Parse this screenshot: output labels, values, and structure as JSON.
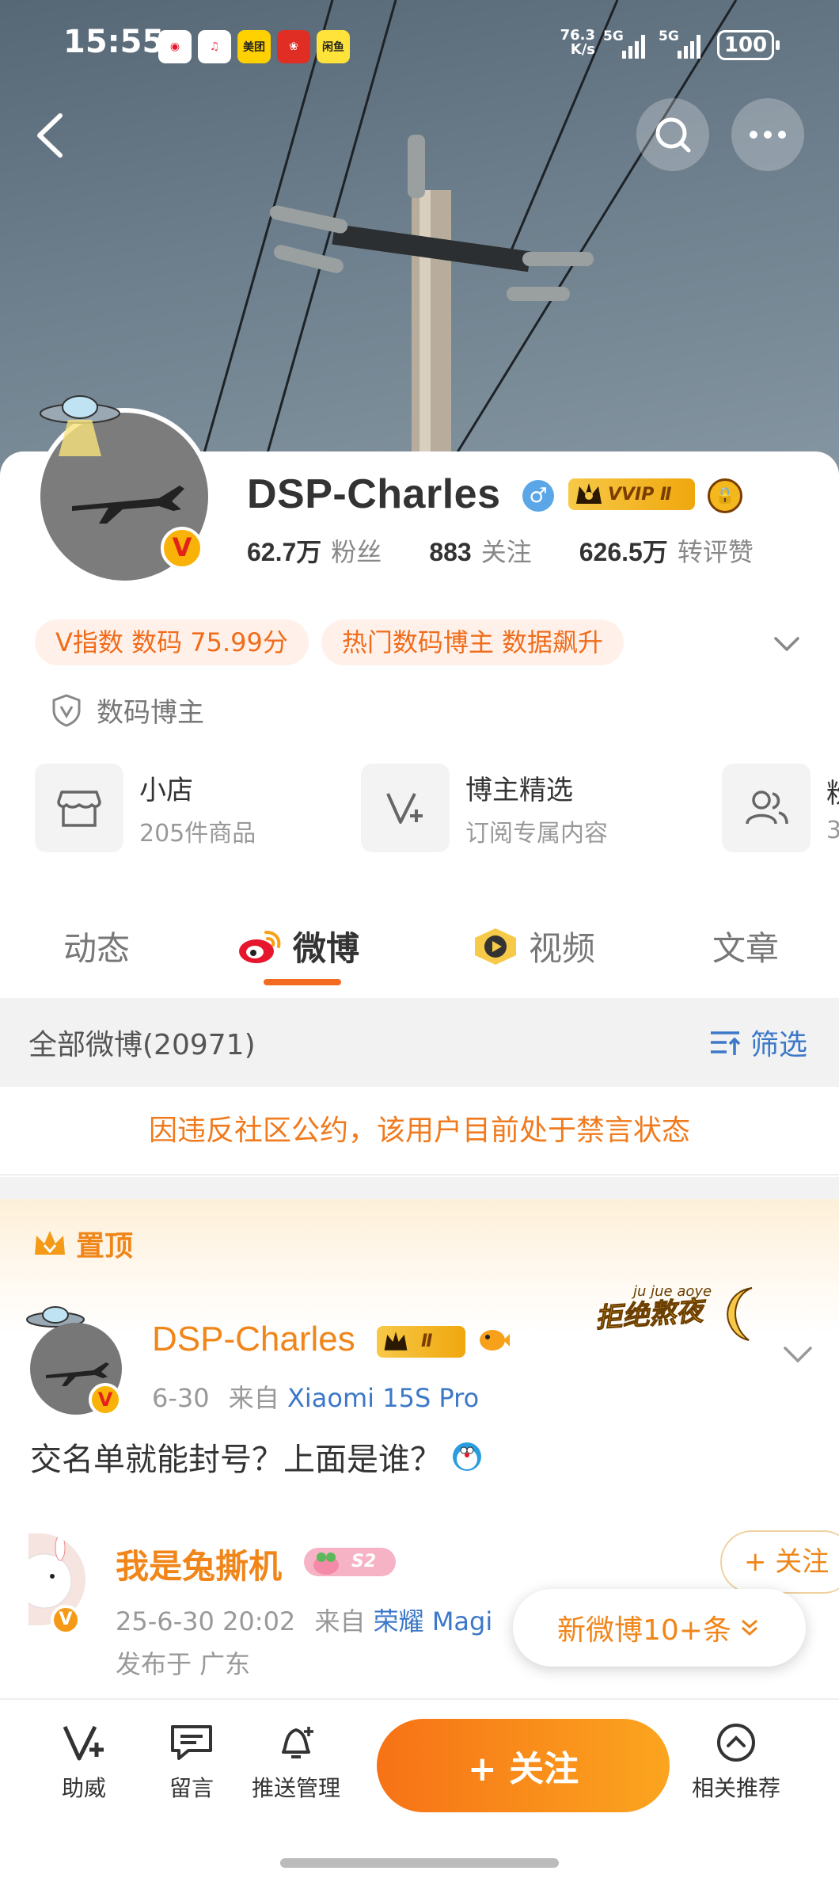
{
  "status_bar": {
    "time": "15:55",
    "apps": [
      "weibo",
      "music",
      "美团",
      "pinduoduo",
      "闲鱼"
    ],
    "net_speed_value": "76.3",
    "net_speed_unit": "K/s",
    "sim1": "5G",
    "sim2": "5G",
    "battery": "100"
  },
  "profile": {
    "name": "DSP-Charles",
    "gender_symbol": "♂",
    "vip_label": "VVIP Ⅱ",
    "stats": [
      {
        "value": "62.7万",
        "label": "粉丝"
      },
      {
        "value": "883",
        "label": "关注"
      },
      {
        "value": "626.5万",
        "label": "转评赞"
      }
    ],
    "tags": [
      "V指数 数码 75.99分",
      "热门数码博主 数据飙升"
    ],
    "certification": "数码博主",
    "services": [
      {
        "title": "小店",
        "sub": "205件商品"
      },
      {
        "title": "博主精选",
        "sub": "订阅专属内容"
      },
      {
        "title": "粉",
        "sub": "3"
      }
    ]
  },
  "tabs": [
    "动态",
    "微博",
    "视频",
    "文章"
  ],
  "feed": {
    "count_label": "全部微博(20971)",
    "filter_label": "筛选",
    "banned_notice": "因违反社区公约，该用户目前处于禁言状态",
    "pinned_label": "置顶",
    "post": {
      "author": "DSP-Charles",
      "level": "Ⅱ",
      "date": "6-30",
      "source_prefix": "来自",
      "source": "Xiaomi 15S Pro",
      "deco_text": "拒绝熬夜",
      "deco_small": "ju jue aoye",
      "text": "交名单就能封号？上面是谁？",
      "repost": {
        "author": "我是兔撕机",
        "badge": "S2",
        "time": "25-6-30 20:02",
        "source_prefix": "来自",
        "source": "荣耀 Magi",
        "location": "发布于 广东",
        "follow_label": "+ 关注"
      }
    },
    "new_posts": "新微博10+条"
  },
  "bottom_bar": {
    "items": [
      "助威",
      "留言",
      "推送管理",
      "相关推荐"
    ],
    "follow_label": "+ 关注"
  },
  "colors": {
    "accent": "#f36b21",
    "link": "#3c78c8",
    "name_orange": "#f0861a"
  }
}
